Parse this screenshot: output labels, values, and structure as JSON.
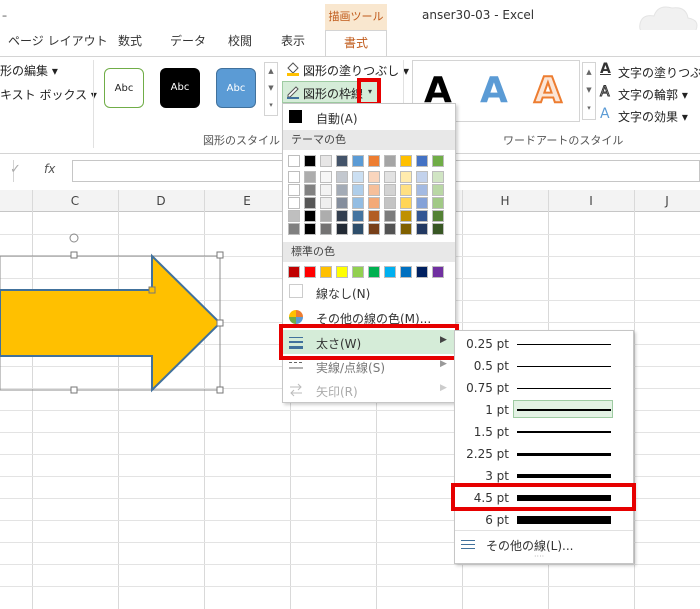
{
  "title_bar": {
    "qat": "ｰ",
    "context_label": "描画ツール",
    "window_title": "anser30-03 - Excel"
  },
  "tabs": [
    {
      "label": "ページ レイアウト"
    },
    {
      "label": "数式"
    },
    {
      "label": "データ"
    },
    {
      "label": "校閲"
    },
    {
      "label": "表示"
    },
    {
      "label": "書式"
    }
  ],
  "ribbon": {
    "edit_shape": "形の編集",
    "text_box": "キスト ボックス",
    "style_samples": [
      "Abc",
      "Abc",
      "Abc"
    ],
    "shape_fill": "図形の塗りつぶし",
    "shape_outline": "図形の枠線",
    "shape_styles_group": "図形のスタイル",
    "wordart_letters": [
      "A",
      "A",
      "A"
    ],
    "text_fill": "文字の塗りつぶし",
    "text_outline": "文字の輪郭",
    "text_effects": "文字の効果",
    "wordart_group": "ワードアートのスタイル"
  },
  "formula_bar": {
    "check": "✓",
    "fx": "fx"
  },
  "columns": [
    "C",
    "D",
    "E",
    "H",
    "I",
    "J"
  ],
  "outline_menu": {
    "automatic": "自動(A)",
    "theme_colors_header": "テーマの色",
    "standard_colors_header": "標準の色",
    "no_outline": "線なし(N)",
    "more_colors": "その他の線の色(M)...",
    "weight": "太さ(W)",
    "dashes": "実線/点線(S)",
    "arrows": "矢印(R)"
  },
  "theme_colors": [
    "#ffffff",
    "#000000",
    "#e7e6e6",
    "#44546a",
    "#5b9bd5",
    "#ed7d31",
    "#a5a5a5",
    "#ffc000",
    "#4472c4",
    "#70ad47"
  ],
  "standard_colors": [
    "#c00000",
    "#ff0000",
    "#ffc000",
    "#ffff00",
    "#92d050",
    "#00b050",
    "#00b0f0",
    "#0070c0",
    "#002060",
    "#7030a0"
  ],
  "weight_menu": {
    "options": [
      {
        "label": "0.25 pt"
      },
      {
        "label": "0.5 pt"
      },
      {
        "label": "0.75 pt"
      },
      {
        "label": "1 pt"
      },
      {
        "label": "1.5 pt"
      },
      {
        "label": "2.25 pt"
      },
      {
        "label": "3 pt"
      },
      {
        "label": "4.5 pt"
      },
      {
        "label": "6 pt"
      }
    ],
    "more_lines": "その他の線(L)..."
  },
  "colors": {
    "arrow_fill": "#ffc000",
    "arrow_stroke": "#41719c",
    "highlight_red": "#e60000",
    "context_orange": "#c05a1a"
  }
}
